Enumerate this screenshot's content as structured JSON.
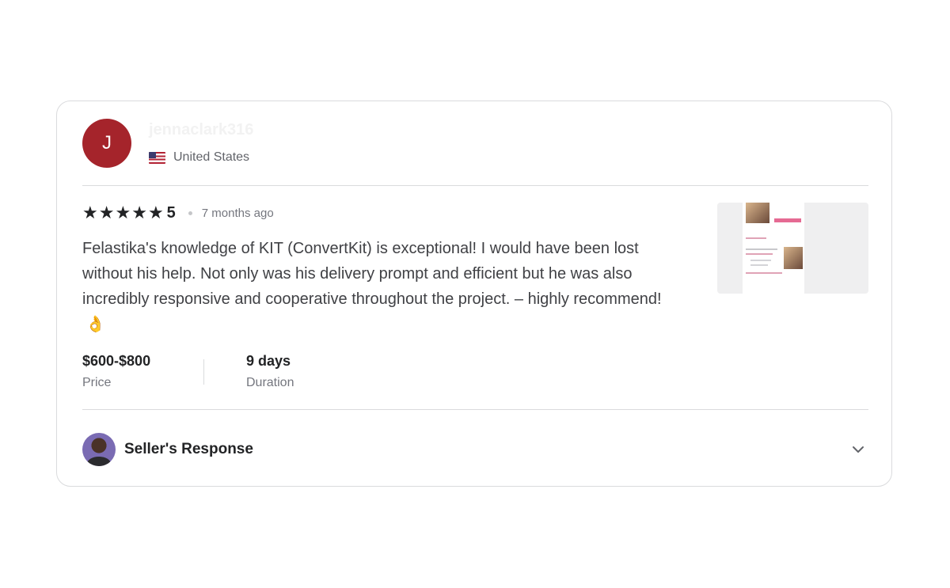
{
  "reviewer": {
    "initial": "J",
    "username": "jennaclark316",
    "country": "United States",
    "avatar_color": "#a5242b"
  },
  "review": {
    "stars": 5,
    "rating_label": "5",
    "time_ago": "7 months ago",
    "text": "Felastika's knowledge of KIT (ConvertKit) is exceptional! I would have been lost without his help. Not only was his delivery prompt and efficient but he was also incredibly responsive and cooperative throughout the project. – highly recommend!",
    "emoji": "👌"
  },
  "details": {
    "price_value": "$600-$800",
    "price_label": "Price",
    "duration_value": "9 days",
    "duration_label": "Duration"
  },
  "seller_response": {
    "title": "Seller's Response"
  },
  "icons": {
    "star": "star-icon",
    "flag": "us-flag-icon",
    "chevron": "chevron-down-icon"
  }
}
